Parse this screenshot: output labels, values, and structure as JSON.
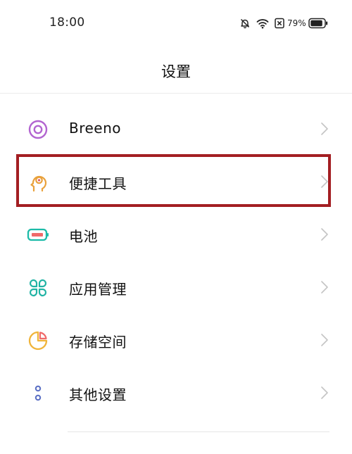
{
  "status_bar": {
    "time": "18:00",
    "battery_percent": "79%",
    "icons": [
      "bell-off-icon",
      "wifi-icon",
      "no-sim-icon",
      "battery-icon"
    ]
  },
  "header": {
    "title": "设置"
  },
  "settings_items": [
    {
      "label": "Breeno",
      "icon": "breeno-icon",
      "color": "#b264d0"
    },
    {
      "label": "便捷工具",
      "icon": "convenience-tools-icon",
      "color": "#e9a13b"
    },
    {
      "label": "电池",
      "icon": "battery-icon",
      "color": "#1dbba8"
    },
    {
      "label": "应用管理",
      "icon": "app-grid-icon",
      "color": "#20b3a4"
    },
    {
      "label": "存储空间",
      "icon": "storage-pie-icon",
      "color": "#f0b43a"
    },
    {
      "label": "其他设置",
      "icon": "more-dots-icon",
      "color": "#5a6fc4"
    }
  ],
  "highlighted_item": "便捷工具",
  "colors": {
    "highlight_border": "#a31e22",
    "chevron": "#c4c4c4"
  }
}
